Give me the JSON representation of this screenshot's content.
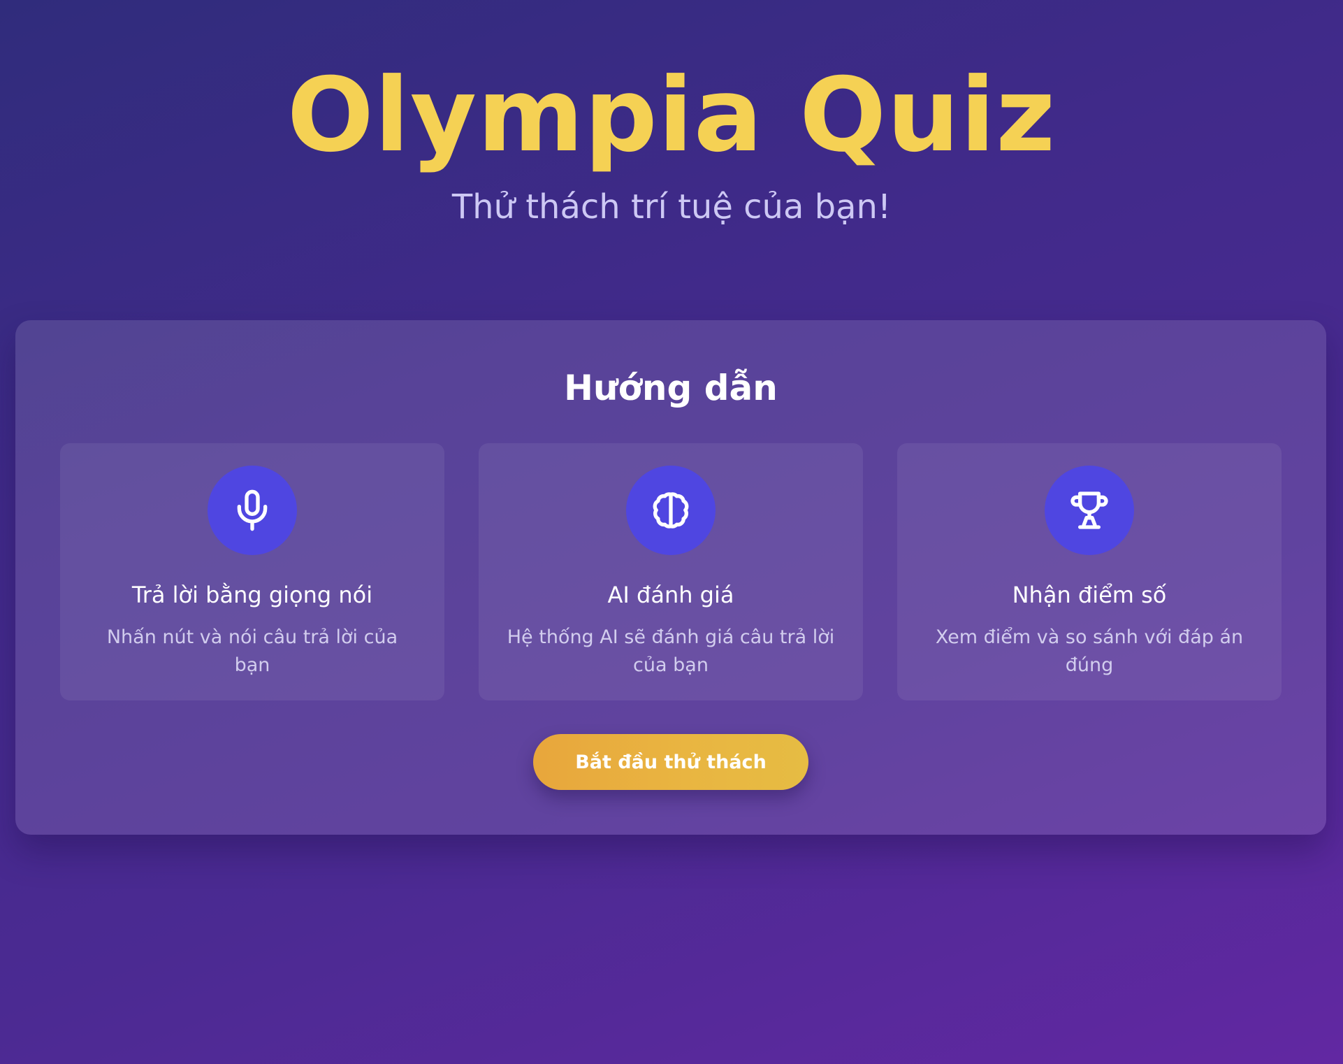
{
  "header": {
    "title": "Olympia Quiz",
    "subtitle": "Thử thách trí tuệ của bạn!"
  },
  "instructions": {
    "title": "Hướng dẫn",
    "cards": [
      {
        "icon": "microphone-icon",
        "title": "Trả lời bằng giọng nói",
        "description": "Nhấn nút và nói câu trả lời của bạn"
      },
      {
        "icon": "brain-icon",
        "title": "AI đánh giá",
        "description": "Hệ thống AI sẽ đánh giá câu trả lời của bạn"
      },
      {
        "icon": "trophy-icon",
        "title": "Nhận điểm số",
        "description": "Xem điểm và so sánh với đáp án đúng"
      }
    ],
    "start_button_label": "Bắt đầu thử thách"
  },
  "colors": {
    "title": "#f5d154",
    "icon_circle": "#4f46e1",
    "button": "#e9b541",
    "background_start": "#302c7c",
    "background_end": "#6228a2"
  }
}
